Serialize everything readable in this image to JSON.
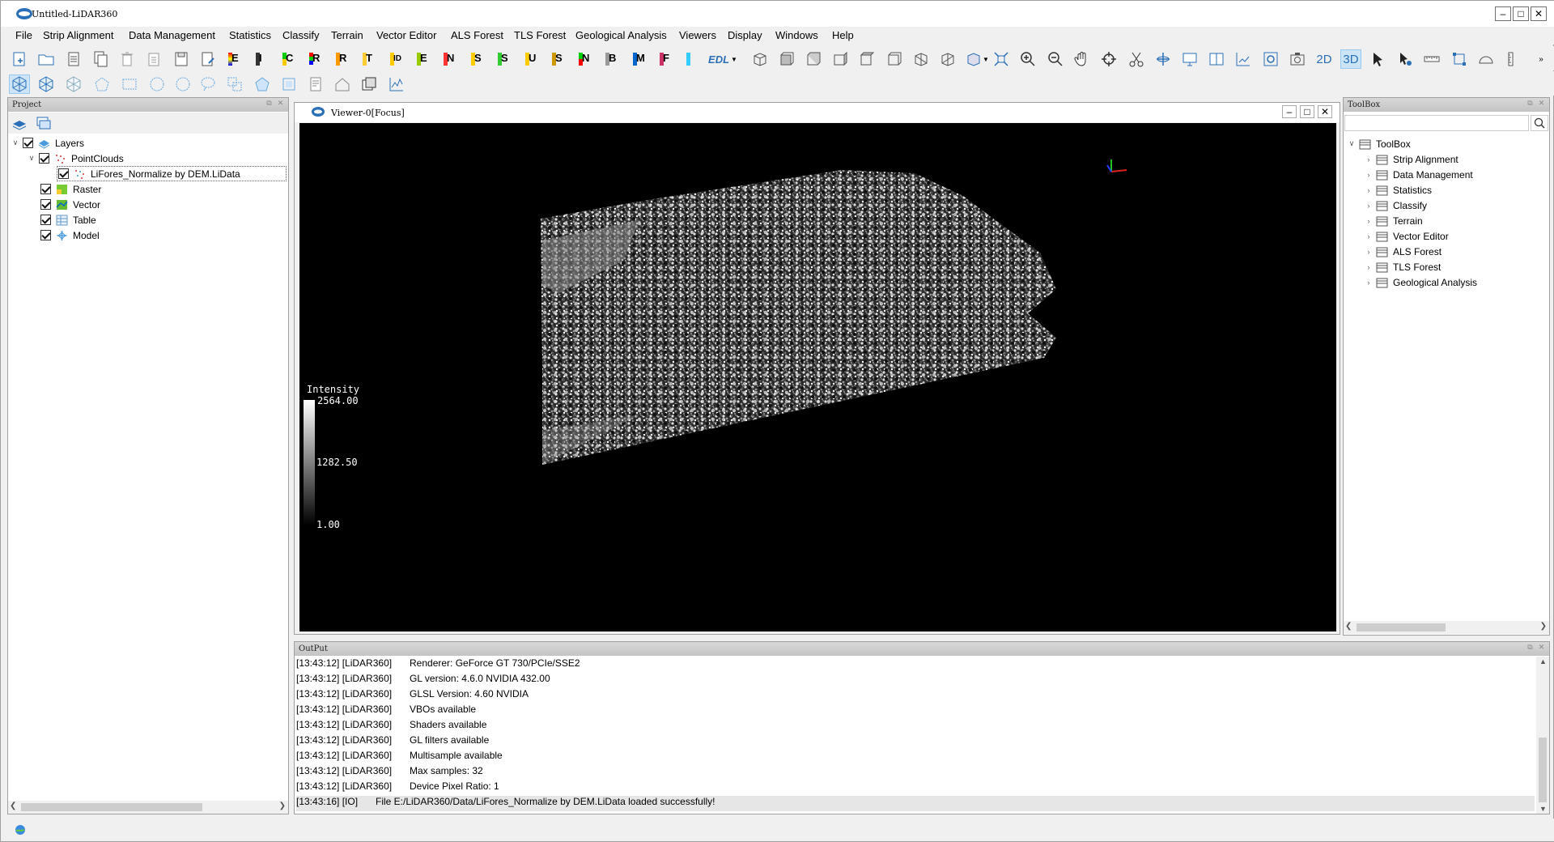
{
  "window": {
    "title": "Untitled-LiDAR360"
  },
  "menu": [
    "File",
    "Strip Alignment",
    "Data Management",
    "Statistics",
    "Classify",
    "Terrain",
    "Vector Editor",
    "ALS Forest",
    "TLS Forest",
    "Geological Analysis",
    "Viewers",
    "Display",
    "Windows",
    "Help"
  ],
  "toolbar": {
    "mode_2d": "2D",
    "mode_3d": "3D",
    "edl": "EDL",
    "color_letters": [
      "E",
      "I",
      "C",
      "R",
      "R",
      "T",
      "ID",
      "E",
      "N",
      "S",
      "S",
      "U",
      "S",
      "N",
      "B",
      "M",
      "F"
    ]
  },
  "project_panel": {
    "title": "Project",
    "layers": [
      {
        "label": "Layers",
        "checked": true,
        "icon": "layers-icon"
      },
      {
        "label": "PointClouds",
        "checked": true,
        "icon": "pointcloud-icon"
      },
      {
        "label": "LiFores_Normalize by DEM.LiData",
        "checked": true,
        "icon": "lidata-icon"
      },
      {
        "label": "Raster",
        "checked": true,
        "icon": "raster-icon"
      },
      {
        "label": "Vector",
        "checked": true,
        "icon": "vector-icon"
      },
      {
        "label": "Table",
        "checked": true,
        "icon": "table-icon"
      },
      {
        "label": "Model",
        "checked": true,
        "icon": "model-icon"
      }
    ]
  },
  "viewer": {
    "title": "Viewer-0[Focus]",
    "legend": {
      "title": "Intensity",
      "max": "2564.00",
      "mid": "1282.50",
      "min": "1.00"
    }
  },
  "toolbox_panel": {
    "title": "ToolBox",
    "search_placeholder": "",
    "root": "ToolBox",
    "items": [
      "Strip Alignment",
      "Data Management",
      "Statistics",
      "Classify",
      "Terrain",
      "Vector Editor",
      "ALS Forest",
      "TLS Forest",
      "Geological Analysis"
    ]
  },
  "output_panel": {
    "title": "OutPut",
    "lines": [
      {
        "ts": "[13:43:12] [LiDAR360]",
        "msg": "Renderer: GeForce GT 730/PCIe/SSE2"
      },
      {
        "ts": "[13:43:12] [LiDAR360]",
        "msg": "GL version: 4.6.0 NVIDIA 432.00"
      },
      {
        "ts": "[13:43:12] [LiDAR360]",
        "msg": "GLSL Version: 4.60 NVIDIA"
      },
      {
        "ts": "[13:43:12] [LiDAR360]",
        "msg": "VBOs available"
      },
      {
        "ts": "[13:43:12] [LiDAR360]",
        "msg": "Shaders available"
      },
      {
        "ts": "[13:43:12] [LiDAR360]",
        "msg": "GL filters available"
      },
      {
        "ts": "[13:43:12] [LiDAR360]",
        "msg": "Multisample available"
      },
      {
        "ts": "[13:43:12] [LiDAR360]",
        "msg": "Max samples: 32"
      },
      {
        "ts": "[13:43:12] [LiDAR360]",
        "msg": "Device Pixel Ratio: 1"
      },
      {
        "ts": "[13:43:16] [IO]",
        "msg": "File E:/LiDAR360/Data/LiFores_Normalize by DEM.LiData loaded successfully!"
      }
    ]
  }
}
